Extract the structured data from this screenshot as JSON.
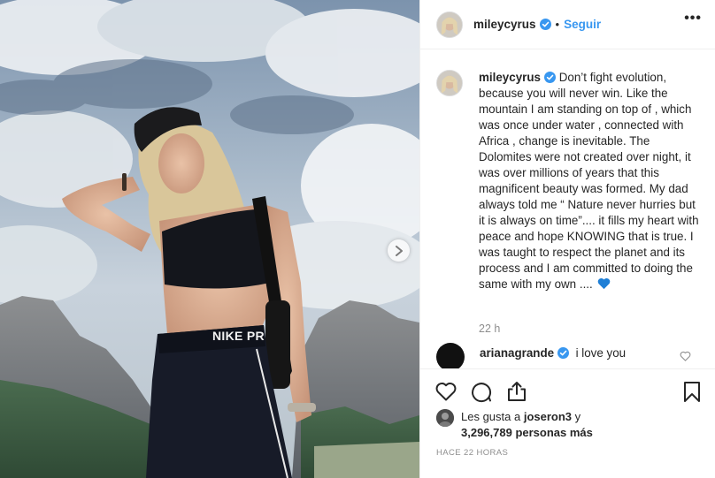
{
  "post": {
    "author": "mileycyrus",
    "follow_label": "Seguir",
    "dot_separator": "•",
    "more_label": "•••",
    "media_shorts_text": "NIKE PR",
    "caption": "Don’t fight evolution, because you will never win. Like the mountain I am standing on top of , which was once under water , connected with Africa , change is inevitable. The Dolomites were not created over night, it was over millions of years that this magnificent beauty was formed. My dad always told me “ Nature never hurries but it is always on time”.... it fills my heart with peace and hope KNOWING that is true. I was taught to respect the planet and its process and I am committed to doing the same with my own ....",
    "caption_emoji": "blue-heart",
    "caption_time": "22 h",
    "comments": [
      {
        "author": "arianagrande",
        "text": "i love you"
      }
    ],
    "likes": {
      "prefix": "Les gusta a ",
      "user": "joseron3",
      "conjunction": " y",
      "count": "3,296,789 personas más"
    },
    "post_time": "HACE 22 HORAS"
  },
  "colors": {
    "link_blue": "#3897f0",
    "verified_blue": "#3897f0",
    "muted_text": "#8e8e8e",
    "border": "#efefef"
  },
  "icons": [
    "verified-badge-icon",
    "more-options-icon",
    "chevron-right-icon",
    "heart-icon",
    "comment-icon",
    "share-icon",
    "bookmark-icon",
    "blue-heart-emoji"
  ]
}
